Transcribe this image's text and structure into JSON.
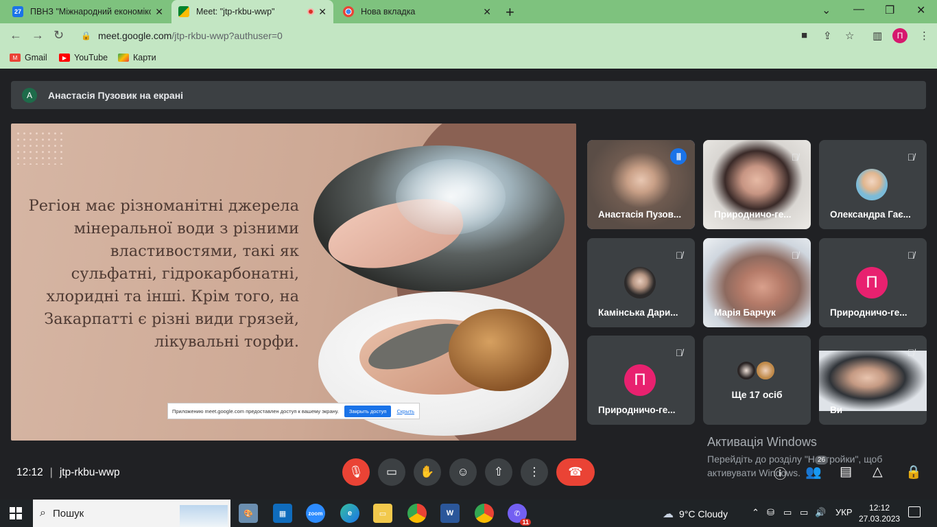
{
  "browser": {
    "tabs": [
      {
        "label": "ПВНЗ \"Міжнародний економіко",
        "icon": "calendar-icon",
        "icon_text": "27"
      },
      {
        "label": "Meet: \"jtp-rkbu-wwp\"",
        "icon": "meet-icon"
      },
      {
        "label": "Нова вкладка",
        "icon": "chrome-icon"
      }
    ],
    "url_host": "meet.google.com",
    "url_rest": "/jtp-rkbu-wwp?authuser=0",
    "profile_initial": "П",
    "bookmarks": [
      {
        "label": "Gmail",
        "icon": "gmail-icon"
      },
      {
        "label": "YouTube",
        "icon": "youtube-icon"
      },
      {
        "label": "Карти",
        "icon": "maps-icon"
      }
    ]
  },
  "meet": {
    "presenter_initial": "А",
    "presenter_text": "Анастасія Пузовик на екрані",
    "slide": {
      "text": "Регіон має різноманітні джерела мінеральної води з різними властивостями, такі як сульфатні, гідрокарбонатні, хлоридні та інші. Крім того, на Закарпатті є різні види грязей, лікувальні торфи.",
      "share_notice": "Приложению meet.google.com предоставлен доступ к вашему экрану.",
      "share_stop": "Закрыть доступ",
      "share_hide": "Скрыть"
    },
    "participants": [
      {
        "name": "Анастасія Пузов...",
        "state": "speaking",
        "kind": "video"
      },
      {
        "name": "Природничо-ге...",
        "state": "muted",
        "kind": "video"
      },
      {
        "name": "Олександра Гає...",
        "state": "muted",
        "kind": "avatar"
      },
      {
        "name": "Камінська Дари...",
        "state": "muted",
        "kind": "avatar"
      },
      {
        "name": "Марія Барчук",
        "state": "muted",
        "kind": "video"
      },
      {
        "name": "Природничо-ге...",
        "state": "muted",
        "kind": "initial",
        "initial": "П"
      },
      {
        "name": "Природничо-ге...",
        "state": "muted",
        "kind": "initial",
        "initial": "П"
      },
      {
        "name": "Ще 17 осіб",
        "state": "none",
        "kind": "more"
      },
      {
        "name": "Ви",
        "state": "muted",
        "kind": "video"
      }
    ],
    "windows_activation": {
      "title": "Активація Windows",
      "text": "Перейдіть до розділу \"Настройки\", щоб активувати Windows."
    },
    "time": "12:12",
    "meeting_code": "jtp-rkbu-wwp",
    "participants_badge": "26",
    "accent_color": "#8ab4f8",
    "end_call_color": "#ea4335"
  },
  "taskbar": {
    "search_placeholder": "Пошук",
    "weather": "9°C  Cloudy",
    "lang": "УКР",
    "time": "12:12",
    "date": "27.03.2023",
    "viber_badge": "11",
    "zoom_label": "zoom"
  }
}
